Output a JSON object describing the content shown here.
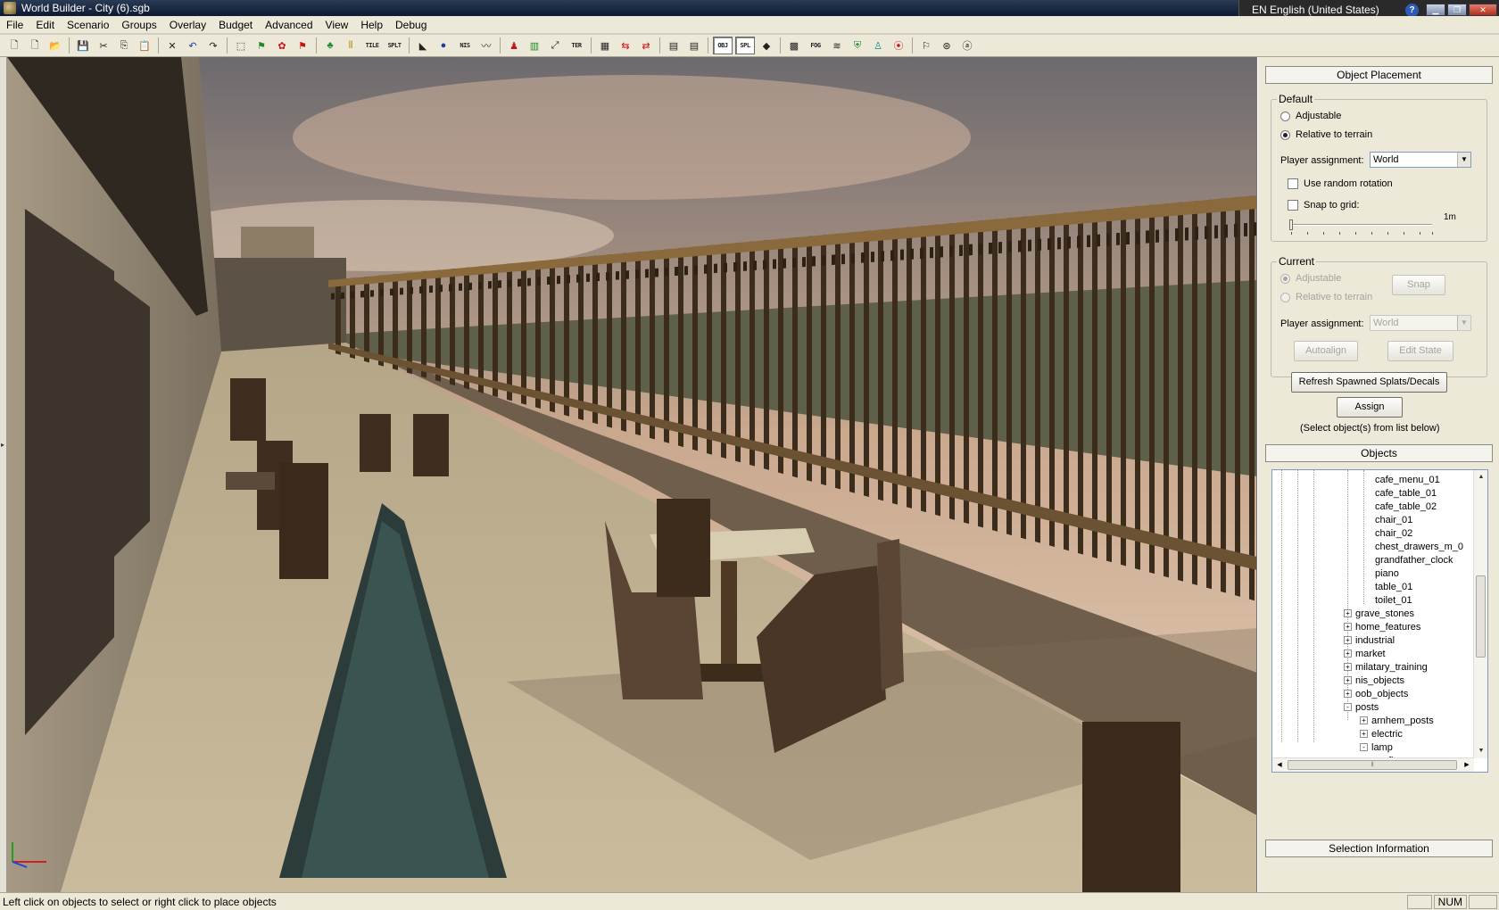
{
  "window": {
    "title": "World Builder - City (6).sgb",
    "language_bar": "EN English (United States)",
    "help_icon": "?"
  },
  "menubar": [
    "File",
    "Edit",
    "Scenario",
    "Groups",
    "Overlay",
    "Budget",
    "Advanced",
    "View",
    "Help",
    "Debug"
  ],
  "toolbar": {
    "text_buttons": [
      "TILE",
      "SPLT",
      "NIS",
      "TER",
      "OBJ",
      "SPL",
      "FOG"
    ],
    "pressed": [
      "OBJ",
      "SPL"
    ]
  },
  "viewport": {
    "scene": "3d-terrace-cafe"
  },
  "object_placement": {
    "header": "Object Placement",
    "default_group": {
      "legend": "Default",
      "options": [
        "Adjustable",
        "Relative to terrain"
      ],
      "selected": "Relative to terrain",
      "player_assignment_label": "Player assignment:",
      "player_assignment_value": "World",
      "use_random_rotation": "Use random rotation",
      "use_random_rotation_checked": false,
      "snap_to_grid": "Snap to grid:",
      "snap_to_grid_checked": false,
      "slider_value_label": "1m"
    },
    "current_group": {
      "legend": "Current",
      "options": [
        "Adjustable",
        "Relative to terrain"
      ],
      "selected": "Adjustable",
      "snap_button": "Snap",
      "player_assignment_label": "Player assignment:",
      "player_assignment_value": "World",
      "autoalign_button": "Autoalign",
      "edit_state_button": "Edit State"
    },
    "refresh_button": "Refresh Spawned Splats/Decals",
    "assign_button": "Assign",
    "hint": "(Select object(s) from list below)"
  },
  "objects": {
    "header": "Objects",
    "tree": [
      {
        "label": "cafe_menu_01",
        "level": 4,
        "expander": null
      },
      {
        "label": "cafe_table_01",
        "level": 4,
        "expander": null
      },
      {
        "label": "cafe_table_02",
        "level": 4,
        "expander": null
      },
      {
        "label": "chair_01",
        "level": 4,
        "expander": null
      },
      {
        "label": "chair_02",
        "level": 4,
        "expander": null
      },
      {
        "label": "chest_drawers_m_0",
        "level": 4,
        "expander": null
      },
      {
        "label": "grandfather_clock",
        "level": 4,
        "expander": null
      },
      {
        "label": "piano",
        "level": 4,
        "expander": null
      },
      {
        "label": "table_01",
        "level": 4,
        "expander": null
      },
      {
        "label": "toilet_01",
        "level": 4,
        "expander": null
      },
      {
        "label": "grave_stones",
        "level": 3,
        "expander": "+"
      },
      {
        "label": "home_features",
        "level": 3,
        "expander": "+"
      },
      {
        "label": "industrial",
        "level": 3,
        "expander": "+"
      },
      {
        "label": "market",
        "level": 3,
        "expander": "+"
      },
      {
        "label": "milatary_training",
        "level": 3,
        "expander": "+"
      },
      {
        "label": "nis_objects",
        "level": 3,
        "expander": "+"
      },
      {
        "label": "oob_objects",
        "level": 3,
        "expander": "+"
      },
      {
        "label": "posts",
        "level": 3,
        "expander": "-"
      },
      {
        "label": "arnhem_posts",
        "level": 4,
        "expander": "+"
      },
      {
        "label": "electric",
        "level": 4,
        "expander": "+"
      },
      {
        "label": "lamp",
        "level": 4,
        "expander": "-"
      },
      {
        "label": "floor",
        "level": 5,
        "expander": null
      }
    ]
  },
  "selection_information": {
    "header": "Selection Information"
  },
  "statusbar": {
    "message": "Left click on objects to select or right click to place objects",
    "num": "NUM"
  }
}
